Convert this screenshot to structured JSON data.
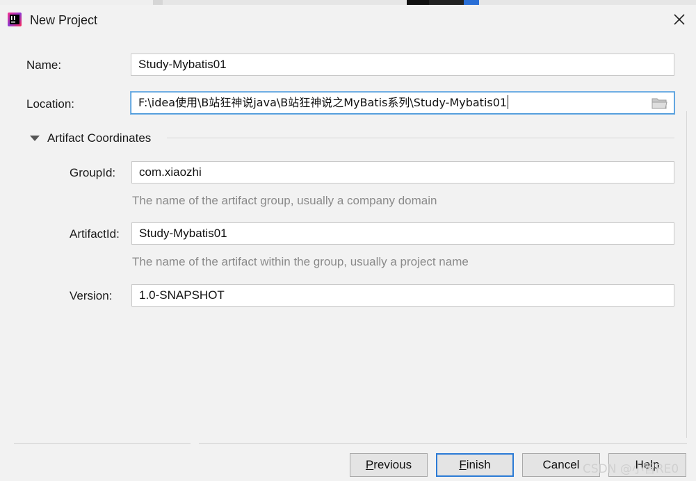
{
  "window": {
    "title": "New Project",
    "close_glyph": "✕"
  },
  "form": {
    "name": {
      "label": "Name:",
      "value": "Study-Mybatis01"
    },
    "location": {
      "label": "Location:",
      "value": "F:\\idea使用\\B站狂神说java\\B站狂神说之MyBatis系列\\Study-Mybatis01"
    }
  },
  "artifact": {
    "section_title": "Artifact Coordinates",
    "expanded": true,
    "group_id": {
      "label": "GroupId:",
      "value": "com.xiaozhi",
      "hint": "The name of the artifact group, usually a company domain"
    },
    "artifact_id": {
      "label": "ArtifactId:",
      "value": "Study-Mybatis01",
      "hint": "The name of the artifact within the group, usually a project name"
    },
    "version": {
      "label": "Version:",
      "value": "1.0-SNAPSHOT"
    }
  },
  "buttons": {
    "previous": {
      "mnemonic": "P",
      "rest": "revious"
    },
    "finish": {
      "mnemonic": "F",
      "rest": "inish"
    },
    "cancel": {
      "label": "Cancel"
    },
    "help": {
      "label": "Help"
    }
  },
  "watermark": "CSDN @小智RE0",
  "icons": {
    "app": "intellij-idea-icon",
    "folder": "folder-icon",
    "toggle": "triangle-down-icon"
  },
  "colors": {
    "focus_border": "#3a8fd6",
    "default_button_border": "#2b7bd6",
    "hint_text": "#8a8a8a",
    "dialog_bg": "#f2f2f2"
  }
}
